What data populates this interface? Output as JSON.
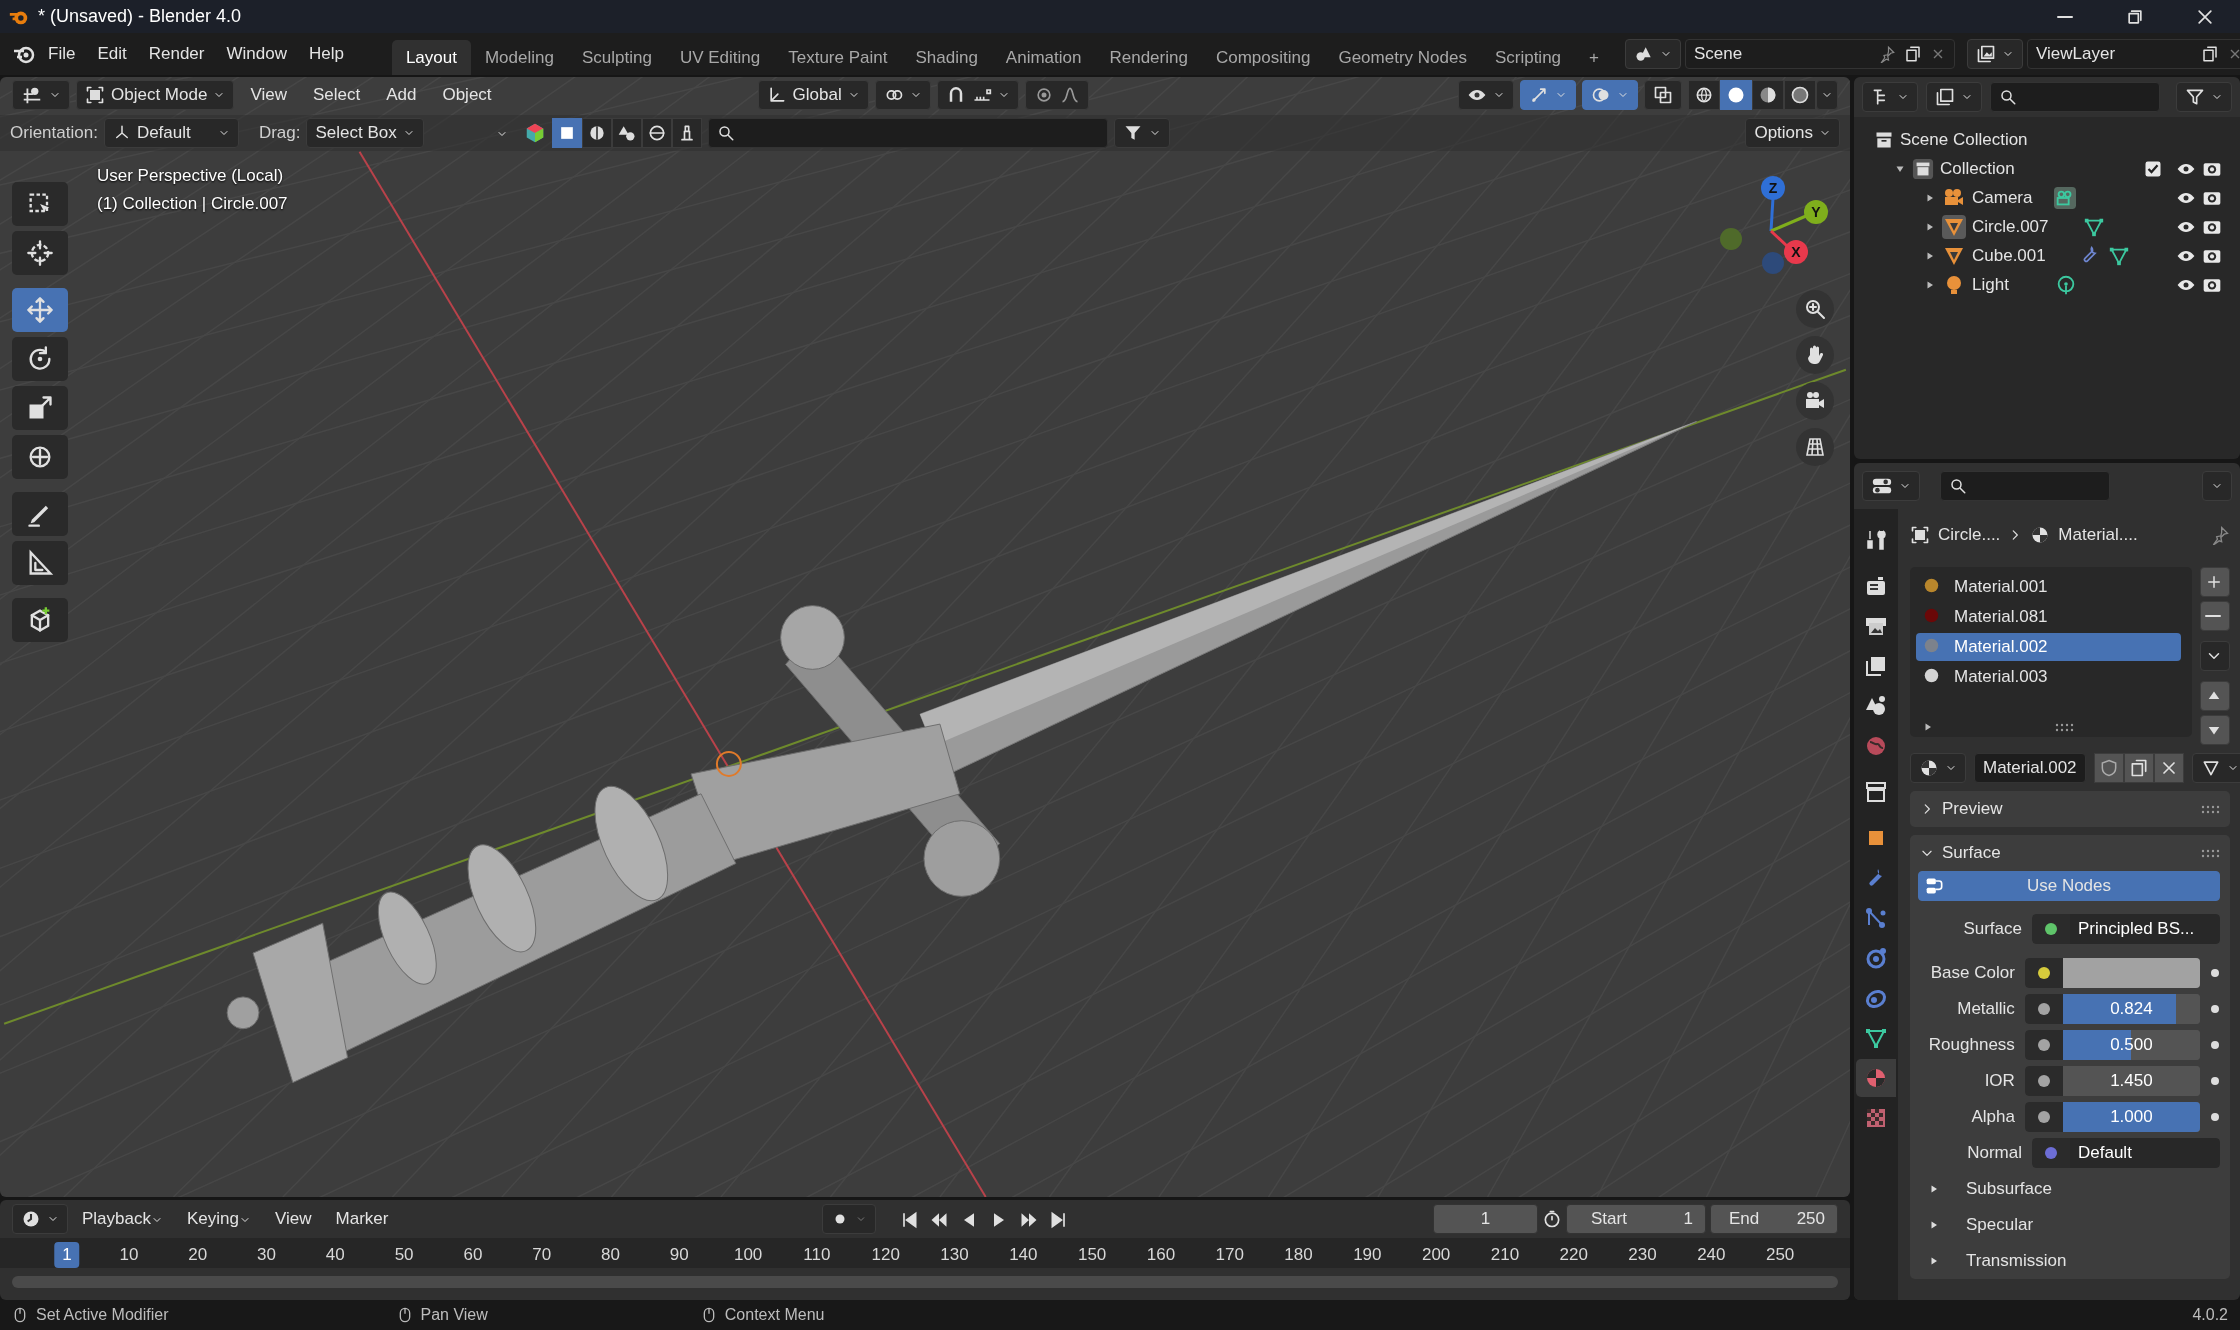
{
  "window": {
    "title": "* (Unsaved) - Blender 4.0"
  },
  "menu": [
    "File",
    "Edit",
    "Render",
    "Window",
    "Help"
  ],
  "workspaces": [
    {
      "label": "Layout",
      "selected": true
    },
    {
      "label": "Modeling",
      "selected": false
    },
    {
      "label": "Sculpting",
      "selected": false
    },
    {
      "label": "UV Editing",
      "selected": false
    },
    {
      "label": "Texture Paint",
      "selected": false
    },
    {
      "label": "Shading",
      "selected": false
    },
    {
      "label": "Animation",
      "selected": false
    },
    {
      "label": "Rendering",
      "selected": false
    },
    {
      "label": "Compositing",
      "selected": false
    },
    {
      "label": "Geometry Nodes",
      "selected": false
    },
    {
      "label": "Scripting",
      "selected": false
    }
  ],
  "add_workspace": "+",
  "scene": "Scene",
  "view_layer": "ViewLayer",
  "viewport": {
    "mode": "Object Mode",
    "menus": [
      "View",
      "Select",
      "Add",
      "Object"
    ],
    "transform_orientation": "Global",
    "gizmos_on": true,
    "overlays_on": true,
    "shading_modes": [
      {
        "selected": false
      },
      {
        "selected": true
      },
      {
        "selected": false
      },
      {
        "selected": false
      }
    ],
    "orientation_label": "Orientation:",
    "orientation": "Default",
    "drag_label": "Drag:",
    "drag": "Select Box",
    "options": "Options",
    "selection_modes": [
      {
        "selected": true
      },
      {
        "selected": false
      },
      {
        "selected": false
      },
      {
        "selected": false
      },
      {
        "selected": false
      }
    ],
    "info": [
      "User Perspective (Local)",
      "(1) Collection | Circle.007"
    ],
    "tools": [
      {
        "kind": "select",
        "selected": false
      },
      {
        "kind": "cursor",
        "selected": false
      },
      {
        "kind": "move",
        "selected": true
      },
      {
        "kind": "rotate",
        "selected": false
      },
      {
        "kind": "scale",
        "selected": false
      },
      {
        "kind": "transform",
        "selected": false
      },
      {
        "kind": "annotate",
        "selected": false
      },
      {
        "kind": "measure",
        "selected": false
      },
      {
        "kind": "add-cube",
        "selected": false
      }
    ],
    "gizmo_axes": [
      {
        "label": "Z",
        "color": "#2f6fd6"
      },
      {
        "label": "Y",
        "color": "#7fae1c"
      },
      {
        "label": "X",
        "color": "#e8394c"
      }
    ]
  },
  "outliner": {
    "root": "Scene Collection",
    "collections": [
      {
        "label": "Collection",
        "expanded": true,
        "checked": true,
        "children": [
          {
            "label": "Camera",
            "kind": "camera",
            "selected": false,
            "has_modifier": false
          },
          {
            "label": "Circle.007",
            "kind": "mesh",
            "selected": true,
            "has_modifier": false
          },
          {
            "label": "Cube.001",
            "kind": "mesh",
            "selected": false,
            "has_modifier": true
          },
          {
            "label": "Light",
            "kind": "light",
            "selected": false,
            "has_modifier": false
          }
        ]
      }
    ]
  },
  "properties": {
    "tabs": [
      {
        "kind": "tool",
        "selected": false
      },
      {
        "kind": "render",
        "selected": false
      },
      {
        "kind": "output",
        "selected": false
      },
      {
        "kind": "view-layer",
        "selected": false
      },
      {
        "kind": "scene",
        "selected": false
      },
      {
        "kind": "world",
        "selected": false
      },
      {
        "kind": "collection",
        "selected": false
      },
      {
        "kind": "object",
        "selected": false
      },
      {
        "kind": "modifier",
        "selected": false
      },
      {
        "kind": "particles",
        "selected": false
      },
      {
        "kind": "physics",
        "selected": false
      },
      {
        "kind": "constraint",
        "selected": false
      },
      {
        "kind": "data",
        "selected": false
      },
      {
        "kind": "material",
        "selected": true
      },
      {
        "kind": "texture",
        "selected": false
      }
    ],
    "breadcrumb": [
      "Circle....",
      "Material...."
    ],
    "material_slots": [
      {
        "name": "Material.001",
        "color": "#b8862c",
        "selected": false
      },
      {
        "name": "Material.081",
        "color": "#6a0808",
        "selected": false
      },
      {
        "name": "Material.002",
        "color": "#7c828c",
        "selected": true
      },
      {
        "name": "Material.003",
        "color": "#d4d4d4",
        "selected": false
      }
    ],
    "material_name": "Material.002",
    "panels": [
      {
        "title": "Preview",
        "expanded": false
      },
      {
        "title": "Surface",
        "expanded": true
      }
    ],
    "use_nodes": "Use Nodes",
    "inputs": [
      {
        "kind": "link",
        "label": "Surface",
        "value": "Principled BS...",
        "color": "#5fc46a"
      },
      {
        "kind": "color",
        "label": "Base Color",
        "color": "#d6cb3c",
        "swatch": {
          "color": "#a2a2a2"
        }
      },
      {
        "kind": "slider",
        "label": "Metallic",
        "value": "0.824",
        "level": 0.824,
        "color": "#a3a3a3"
      },
      {
        "kind": "slider",
        "label": "Roughness",
        "value": "0.500",
        "level": 0.5,
        "color": "#a3a3a3"
      },
      {
        "kind": "number",
        "label": "IOR",
        "value": "1.450",
        "color": "#a3a3a3"
      },
      {
        "kind": "slider",
        "label": "Alpha",
        "value": "1.000",
        "level": 1,
        "color": "#a3a3a3"
      },
      {
        "kind": "link",
        "label": "Normal",
        "value": "Default",
        "color": "#6d6ed6"
      }
    ],
    "subpanels": [
      {
        "title": "Subsurface",
        "expanded": false
      },
      {
        "title": "Specular",
        "expanded": false
      },
      {
        "title": "Transmission",
        "expanded": false
      }
    ]
  },
  "timeline": {
    "menus": [
      "Playback",
      "Keying",
      "View",
      "Marker"
    ],
    "current_frame": "1",
    "start_label": "Start",
    "start": "1",
    "end_label": "End",
    "end": "250",
    "ruler": [
      "1",
      "10",
      "20",
      "30",
      "40",
      "50",
      "60",
      "70",
      "80",
      "90",
      "100",
      "110",
      "120",
      "130",
      "140",
      "150",
      "160",
      "170",
      "180",
      "190",
      "200",
      "210",
      "220",
      "230",
      "240",
      "250"
    ]
  },
  "status_bar": {
    "hints": [
      "Set Active Modifier",
      "Pan View",
      "Context Menu"
    ],
    "version": "4.0.2"
  }
}
